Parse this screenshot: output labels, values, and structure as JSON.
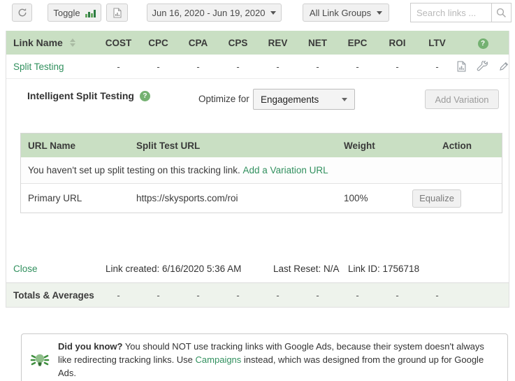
{
  "toolbar": {
    "toggle_label": "Toggle",
    "date_range": "Jun 16, 2020 - Jun 19, 2020",
    "link_groups": "All Link Groups",
    "search_placeholder": "Search links ..."
  },
  "icons": {
    "help_glyph": "?"
  },
  "stats": {
    "link_name_header": "Link Name",
    "columns": [
      "COST",
      "CPC",
      "CPA",
      "CPS",
      "REV",
      "NET",
      "EPC",
      "ROI",
      "LTV"
    ],
    "row": {
      "name": "Split Testing",
      "values": [
        "-",
        "-",
        "-",
        "-",
        "-",
        "-",
        "-",
        "-",
        "-"
      ]
    },
    "totals": {
      "label": "Totals & Averages",
      "values": [
        "-",
        "-",
        "-",
        "-",
        "-",
        "-",
        "-",
        "-",
        "-"
      ]
    }
  },
  "panel": {
    "title": "Intelligent Split Testing",
    "optimize_label": "Optimize for",
    "optimize_value": "Engagements",
    "add_variation_label": "Add Variation",
    "split_table": {
      "headers": [
        "URL Name",
        "Split Test URL",
        "Weight",
        "Action"
      ],
      "notice_text": "You haven't set up split testing on this tracking link.",
      "notice_link": "Add a Variation URL",
      "primary_row": {
        "name": "Primary URL",
        "url": "https://skysports.com/roi",
        "weight": "100%",
        "action_label": "Equalize"
      }
    },
    "footer": {
      "close": "Close",
      "created": "Link created: 6/16/2020 5:36 AM",
      "last_reset": "Last Reset: N/A",
      "link_id": "Link ID: 1756718"
    }
  },
  "tip": {
    "bold": "Did you know?",
    "text_1": " You should NOT use tracking links with Google Ads, because their system doesn't always like redirecting tracking links. Use ",
    "link": "Campaigns",
    "text_2": " instead, which was designed from the ground up for Google Ads."
  },
  "colors": {
    "accent_green": "#31905e",
    "header_green": "#c9dfc3",
    "totals_green": "#eef3ec",
    "help_badge_green": "#74b171"
  }
}
